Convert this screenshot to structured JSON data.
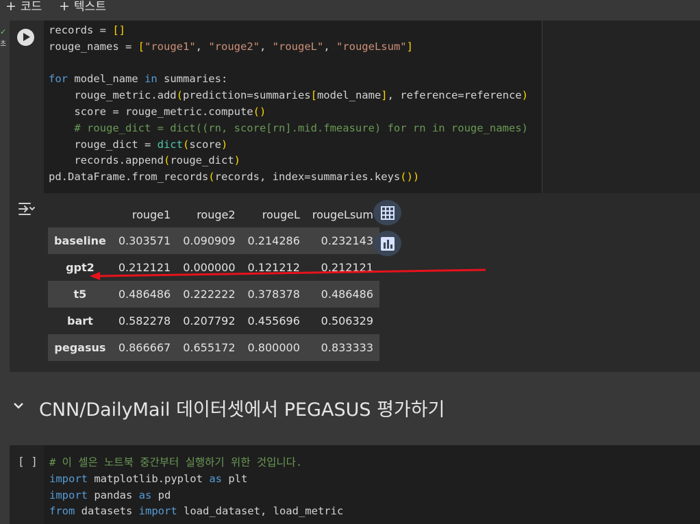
{
  "toolbar": {
    "code_label": "코드",
    "text_label": "텍스트"
  },
  "cell1": {
    "status_check": "✓",
    "status_time": "초",
    "code_lines": [
      [
        [
          "",
          "records = "
        ],
        [
          "br",
          "[]"
        ]
      ],
      [
        [
          "",
          "rouge_names = "
        ],
        [
          "br",
          "["
        ],
        [
          "str",
          "\"rouge1\""
        ],
        [
          "",
          ", "
        ],
        [
          "str",
          "\"rouge2\""
        ],
        [
          "",
          ", "
        ],
        [
          "str",
          "\"rougeL\""
        ],
        [
          "",
          ", "
        ],
        [
          "str",
          "\"rougeLsum\""
        ],
        [
          "br",
          "]"
        ]
      ],
      [],
      [
        [
          "kw",
          "for"
        ],
        [
          "",
          " model_name "
        ],
        [
          "kw",
          "in"
        ],
        [
          "",
          " summaries:"
        ]
      ],
      [
        [
          "",
          "    rouge_metric.add"
        ],
        [
          "br",
          "("
        ],
        [
          "",
          "prediction=summaries"
        ],
        [
          "br",
          "["
        ],
        [
          "",
          "model_name"
        ],
        [
          "br",
          "]"
        ],
        [
          "",
          ", reference=reference"
        ],
        [
          "br",
          ")"
        ]
      ],
      [
        [
          "",
          "    score = rouge_metric.compute"
        ],
        [
          "br",
          "()"
        ]
      ],
      [
        [
          "cm",
          "    # rouge_dict = dict((rn, score[rn].mid.fmeasure) for rn in rouge_names)"
        ]
      ],
      [
        [
          "",
          "    rouge_dict = "
        ],
        [
          "bi",
          "dict"
        ],
        [
          "br",
          "("
        ],
        [
          "",
          "score"
        ],
        [
          "br",
          ")"
        ]
      ],
      [
        [
          "",
          "    records.append"
        ],
        [
          "br",
          "("
        ],
        [
          "",
          "rouge_dict"
        ],
        [
          "br",
          ")"
        ]
      ],
      [
        [
          "",
          "pd.DataFrame.from_records"
        ],
        [
          "br",
          "("
        ],
        [
          "",
          "records, index=summaries.keys"
        ],
        [
          "br",
          "())"
        ]
      ]
    ]
  },
  "table": {
    "columns": [
      "",
      "rouge1",
      "rouge2",
      "rougeL",
      "rougeLsum"
    ],
    "rows": [
      {
        "index": "baseline",
        "values": [
          "0.303571",
          "0.090909",
          "0.214286",
          "0.232143"
        ]
      },
      {
        "index": "gpt2",
        "values": [
          "0.212121",
          "0.000000",
          "0.121212",
          "0.212121"
        ]
      },
      {
        "index": "t5",
        "values": [
          "0.486486",
          "0.222222",
          "0.378378",
          "0.486486"
        ]
      },
      {
        "index": "bart",
        "values": [
          "0.582278",
          "0.207792",
          "0.455696",
          "0.506329"
        ]
      },
      {
        "index": "pegasus",
        "values": [
          "0.866667",
          "0.655172",
          "0.800000",
          "0.833333"
        ]
      }
    ]
  },
  "section": {
    "title": "CNN/DailyMail 데이터셋에서 PEGASUS 평가하기"
  },
  "cell2": {
    "run_bracket": "[ ]",
    "code_lines": [
      [
        [
          "cm",
          "# 이 셀은 노트북 중간부터 실행하기 위한 것입니다."
        ]
      ],
      [
        [
          "kw",
          "import"
        ],
        [
          "",
          " matplotlib.pyplot "
        ],
        [
          "kw",
          "as"
        ],
        [
          "",
          " plt"
        ]
      ],
      [
        [
          "kw",
          "import"
        ],
        [
          "",
          " pandas "
        ],
        [
          "kw",
          "as"
        ],
        [
          "",
          " pd"
        ]
      ],
      [
        [
          "kw",
          "from"
        ],
        [
          "",
          " datasets "
        ],
        [
          "kw",
          "import"
        ],
        [
          "",
          " load_dataset, load_metric"
        ]
      ]
    ]
  },
  "colors": {
    "background": "#383838",
    "cell": "#2a2a2a",
    "editor": "#1e1e1e",
    "arrow": "#e8121b"
  },
  "icons": [
    "output-collapse-icon",
    "table-icon",
    "chart-icon",
    "chevron-down-icon",
    "run-icon"
  ]
}
